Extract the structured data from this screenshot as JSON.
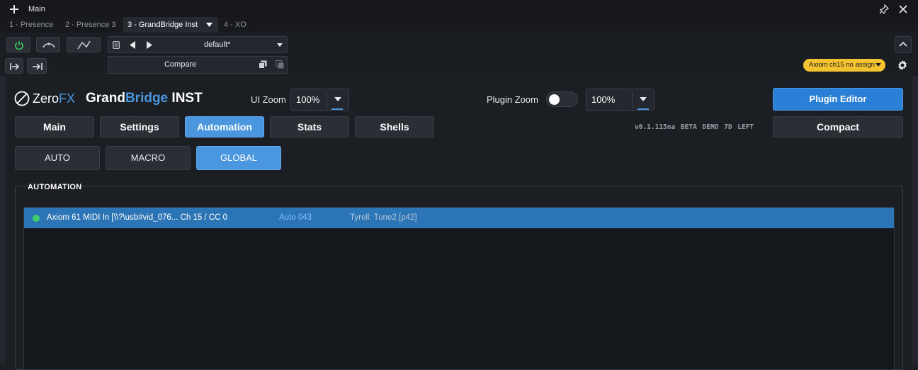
{
  "window": {
    "title": "Main"
  },
  "host_tabs": [
    {
      "label": "1 - Presence"
    },
    {
      "label": "2 - Presence 3"
    },
    {
      "label": "3 - GrandBridge Inst"
    },
    {
      "label": "4 - XO"
    }
  ],
  "preset": {
    "name": "default*",
    "compare_label": "Compare"
  },
  "midi_badge": {
    "label": "Axiom ch15 no assign",
    "color": "#f3c430"
  },
  "plugin": {
    "brand": {
      "zero": "Zero",
      "fx": "FX",
      "grand": "Grand",
      "bridge": "Bridge",
      "inst": "INST"
    },
    "ui_zoom_label": "UI Zoom",
    "ui_zoom_value": "100%",
    "plugin_zoom_label": "Plugin Zoom",
    "plugin_zoom_value": "100%",
    "plugin_zoom_toggle": false,
    "plugin_editor_label": "Plugin Editor",
    "compact_label": "Compact",
    "version": "v0.1.115na BETA DEMO 7D LEFT",
    "accent_color": "#4a97e0",
    "tabs": [
      {
        "label": "Main"
      },
      {
        "label": "Settings"
      },
      {
        "label": "Automation",
        "active": true
      },
      {
        "label": "Stats"
      },
      {
        "label": "Shells"
      }
    ],
    "subtabs": [
      {
        "label": "AUTO"
      },
      {
        "label": "MACRO"
      },
      {
        "label": "GLOBAL",
        "active": true
      }
    ],
    "automation": {
      "title": "AUTOMATION",
      "rows": [
        {
          "status_color": "#3ecf6a",
          "source": "Axiom 61 MIDI In [\\\\?\\usb#vid_076... Ch 15 / CC 0",
          "slot": "Auto 043",
          "target": "Tyrell: Tune2 [p42]"
        }
      ]
    }
  }
}
